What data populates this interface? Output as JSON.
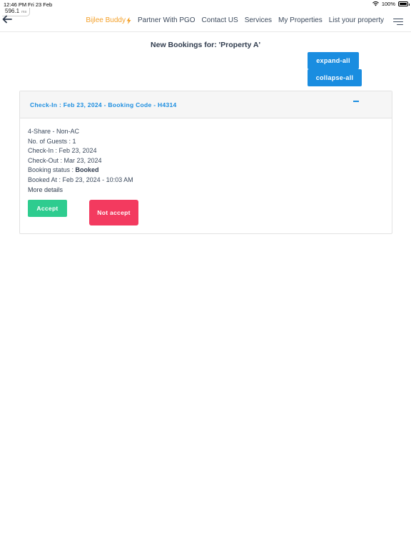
{
  "status_bar": {
    "time": "12:46 PM",
    "date": "Fri 23 Feb",
    "battery": "100%"
  },
  "perf_badge": {
    "value": "596.1",
    "unit": "ms"
  },
  "nav": {
    "brand": "Bijlee Buddy",
    "items": [
      "Partner With PGO",
      "Contact US",
      "Services",
      "My Properties",
      "List your property"
    ]
  },
  "page": {
    "title": "New Bookings for: 'Property A'",
    "expand_all": "expand-all",
    "collapse_all": "collapse-all"
  },
  "booking": {
    "header": "Check-In : Feb 23, 2024 - Booking Code - H4314",
    "room_type": "4-Share - Non-AC",
    "guests_label": "No. of Guests : ",
    "guests": "1",
    "checkin_label": "Check-In : ",
    "checkin": "Feb 23, 2024",
    "checkout_label": "Check-Out : ",
    "checkout": "Mar 23, 2024",
    "status_label": "Booking status : ",
    "status": "Booked",
    "booked_at_label": "Booked At : ",
    "booked_at": "Feb 23, 2024 - 10:03 AM",
    "more_details": "More details",
    "accept_label": "Accept",
    "reject_label": "Not accept"
  },
  "colors": {
    "accent_blue": "#1a8de0",
    "brand_orange": "#f4a12b",
    "accept_green": "#2ecc8f",
    "reject_red": "#f33a5f"
  }
}
